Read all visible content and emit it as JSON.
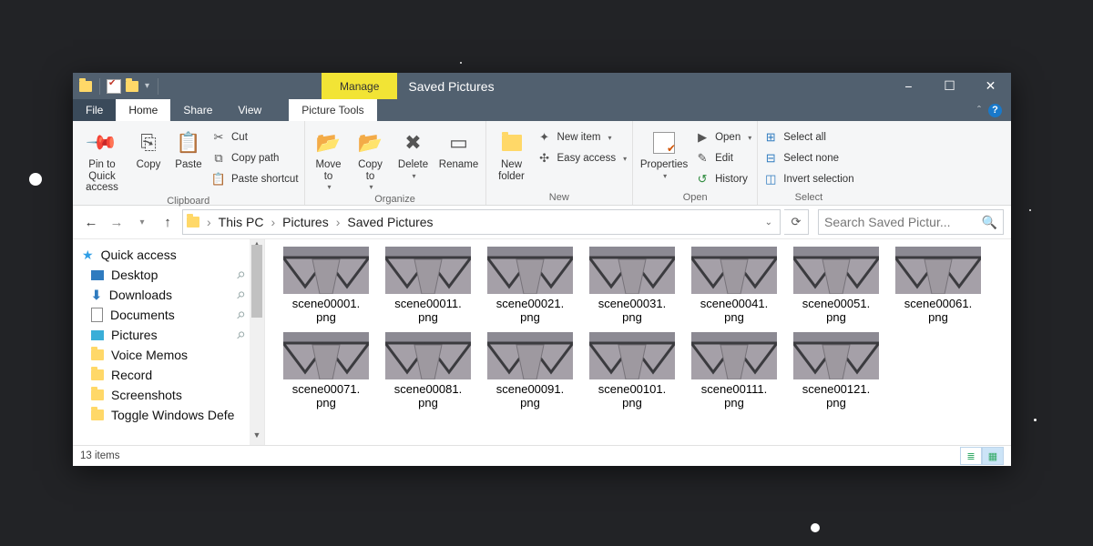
{
  "titlebar": {
    "title": "Saved Pictures",
    "manage": "Manage",
    "picture_tools": "Picture Tools"
  },
  "tabs": {
    "file": "File",
    "home": "Home",
    "share": "Share",
    "view": "View"
  },
  "ribbon": {
    "clipboard": {
      "label": "Clipboard",
      "pin": "Pin to Quick\naccess",
      "copy": "Copy",
      "paste": "Paste",
      "cut": "Cut",
      "copy_path": "Copy path",
      "paste_shortcut": "Paste shortcut"
    },
    "organize": {
      "label": "Organize",
      "move": "Move\nto",
      "copy_to": "Copy\nto",
      "delete": "Delete",
      "rename": "Rename"
    },
    "new": {
      "label": "New",
      "new_folder": "New\nfolder",
      "new_item": "New item",
      "easy_access": "Easy access"
    },
    "open": {
      "label": "Open",
      "properties": "Properties",
      "open": "Open",
      "edit": "Edit",
      "history": "History"
    },
    "select": {
      "label": "Select",
      "select_all": "Select all",
      "select_none": "Select none",
      "invert": "Invert selection"
    }
  },
  "breadcrumb": {
    "this_pc": "This PC",
    "pictures": "Pictures",
    "saved": "Saved Pictures"
  },
  "search": {
    "placeholder": "Search Saved Pictur..."
  },
  "navpane": {
    "quick_access": "Quick access",
    "items": [
      {
        "label": "Desktop",
        "icon": "desktop"
      },
      {
        "label": "Downloads",
        "icon": "download"
      },
      {
        "label": "Documents",
        "icon": "document"
      },
      {
        "label": "Pictures",
        "icon": "pictures"
      },
      {
        "label": "Voice Memos",
        "icon": "folder"
      },
      {
        "label": "Record",
        "icon": "folder"
      },
      {
        "label": "Screenshots",
        "icon": "folder"
      },
      {
        "label": "Toggle Windows Defe",
        "icon": "folder"
      }
    ]
  },
  "files": [
    {
      "name": "scene00001.png"
    },
    {
      "name": "scene00011.png"
    },
    {
      "name": "scene00021.png"
    },
    {
      "name": "scene00031.png"
    },
    {
      "name": "scene00041.png"
    },
    {
      "name": "scene00051.png"
    },
    {
      "name": "scene00061.png"
    },
    {
      "name": "scene00071.png"
    },
    {
      "name": "scene00081.png"
    },
    {
      "name": "scene00091.png"
    },
    {
      "name": "scene00101.png"
    },
    {
      "name": "scene00111.png"
    },
    {
      "name": "scene00121.png"
    }
  ],
  "status": {
    "count": "13 items"
  }
}
